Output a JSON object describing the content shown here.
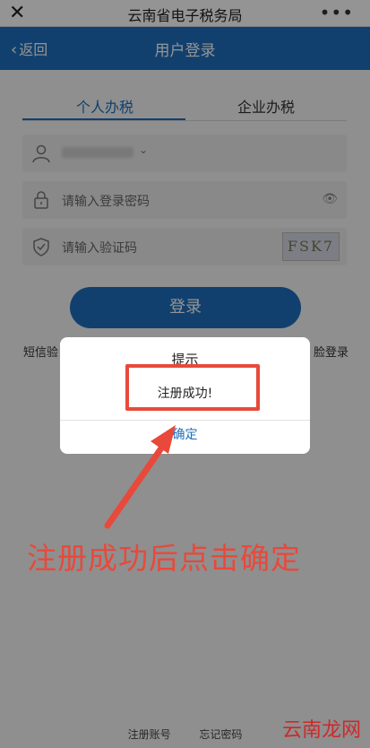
{
  "topbar": {
    "close_icon": "close-icon",
    "title": "云南省电子税务局",
    "more_icon": "more-icon"
  },
  "navbar": {
    "back_label": "返回",
    "title": "用户登录"
  },
  "tabs": [
    {
      "label": "个人办税",
      "active": true
    },
    {
      "label": "企业办税",
      "active": false
    }
  ],
  "form": {
    "username_value": "",
    "password_placeholder": "请输入登录密码",
    "captcha_placeholder": "请输入验证码",
    "captcha_text": "FSK7",
    "login_label": "登录"
  },
  "links": {
    "left_partial": "短信验",
    "right_partial": "脸登录",
    "register": "注册账号",
    "forgot": "忘记密码"
  },
  "dialog": {
    "title": "提示",
    "message": "注册成功!",
    "confirm_label": "确定"
  },
  "annotation": {
    "note": "注册成功后点击确定",
    "accent_color": "#e8493b"
  },
  "watermark": "云南龙网"
}
